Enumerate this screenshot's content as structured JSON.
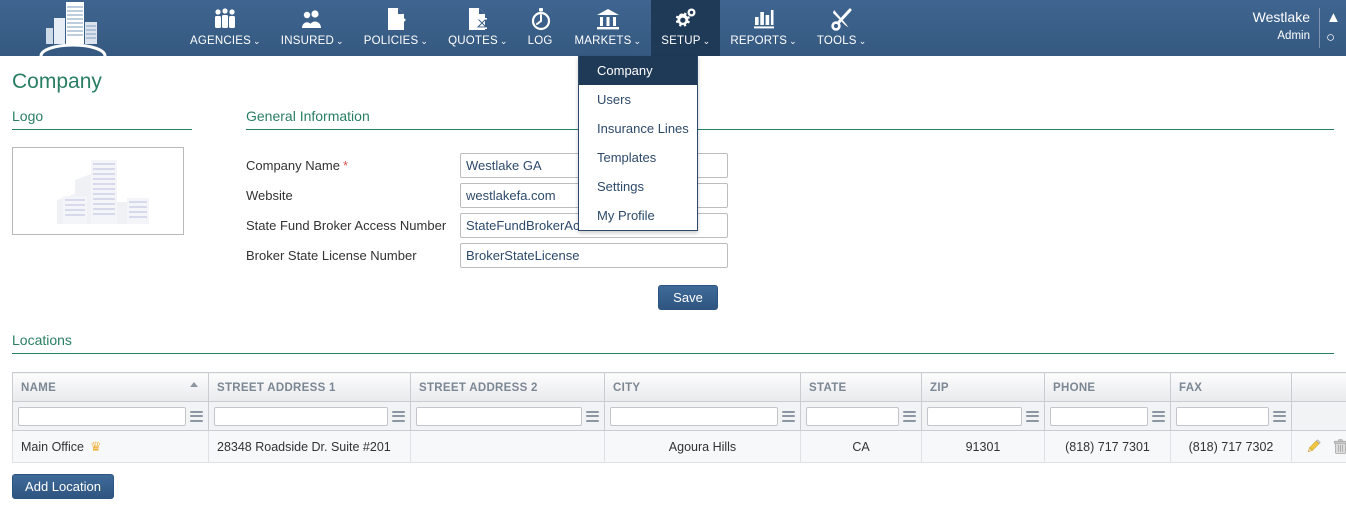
{
  "topbar": {
    "logo_icon": "building-skyline-logo",
    "nav": [
      {
        "label": "AGENCIES",
        "icon": "agencies-people-icon",
        "caret": "⌄",
        "active": false
      },
      {
        "label": "INSURED",
        "icon": "insured-users-icon",
        "caret": "⌄",
        "active": false
      },
      {
        "label": "POLICIES",
        "icon": "policies-doc-check-icon",
        "caret": "⌄",
        "active": false
      },
      {
        "label": "QUOTES",
        "icon": "quotes-doc-hourglass-icon",
        "caret": "⌄",
        "active": false
      },
      {
        "label": "LOG",
        "icon": "log-stopwatch-icon",
        "caret": "",
        "active": false
      },
      {
        "label": "MARKETS",
        "icon": "markets-bank-icon",
        "caret": "⌄",
        "active": false
      },
      {
        "label": "SETUP",
        "icon": "setup-gears-icon",
        "caret": "⌄",
        "active": true
      },
      {
        "label": "REPORTS",
        "icon": "reports-bar-chart-icon",
        "caret": "⌄",
        "active": false
      },
      {
        "label": "TOOLS",
        "icon": "tools-wrench-screwdriver-icon",
        "caret": "⌄",
        "active": false
      }
    ],
    "user": {
      "name": "Westlake",
      "role": "Admin"
    }
  },
  "dropdown": {
    "items": [
      {
        "label": "Company",
        "active": true
      },
      {
        "label": "Users",
        "active": false
      },
      {
        "label": "Insurance Lines",
        "active": false
      },
      {
        "label": "Templates",
        "active": false
      },
      {
        "label": "Settings",
        "active": false
      },
      {
        "label": "My Profile",
        "active": false
      }
    ]
  },
  "page": {
    "title": "Company",
    "logo_section": "Logo",
    "general_section": "General Information",
    "locations_section": "Locations",
    "logo_placeholder_icon": "building-placeholder-icon"
  },
  "form": {
    "fields": [
      {
        "label": "Company Name",
        "required": true,
        "value": "Westlake GA",
        "placeholder": ""
      },
      {
        "label": "Website",
        "required": false,
        "value": "westlakefa.com",
        "placeholder": ""
      },
      {
        "label": "State Fund Broker Access Number",
        "required": false,
        "value": "StateFundBrokerAccessNumber",
        "placeholder": ""
      },
      {
        "label": "Broker State License Number",
        "required": false,
        "value": "BrokerStateLicense",
        "placeholder": ""
      }
    ],
    "save_label": "Save"
  },
  "locations": {
    "add_label": "Add Location",
    "columns": [
      {
        "key": "name",
        "label": "NAME",
        "sorted": "asc",
        "align": "left"
      },
      {
        "key": "addr1",
        "label": "STREET ADDRESS 1",
        "sorted": "none",
        "align": "left"
      },
      {
        "key": "addr2",
        "label": "STREET ADDRESS 2",
        "sorted": "none",
        "align": "left"
      },
      {
        "key": "city",
        "label": "CITY",
        "sorted": "none",
        "align": "center"
      },
      {
        "key": "state",
        "label": "STATE",
        "sorted": "none",
        "align": "center"
      },
      {
        "key": "zip",
        "label": "ZIP",
        "sorted": "none",
        "align": "center"
      },
      {
        "key": "phone",
        "label": "PHONE",
        "sorted": "none",
        "align": "center"
      },
      {
        "key": "fax",
        "label": "FAX",
        "sorted": "none",
        "align": "center"
      },
      {
        "key": "actions",
        "label": "",
        "sorted": "none",
        "align": "left"
      }
    ],
    "filters": {
      "name": "",
      "addr1": "",
      "addr2": "",
      "city": "",
      "state": "",
      "zip": "",
      "phone": "",
      "fax": ""
    },
    "rows": [
      {
        "name": "Main Office",
        "primary_badge": "♛",
        "addr1": "28348 Roadside Dr. Suite #201",
        "addr2": "",
        "city": "Agoura Hills",
        "state": "CA",
        "zip": "91301",
        "phone": "(818) 717 7301",
        "fax": "(818) 717 7302",
        "edit_icon": "pencil-edit-icon",
        "delete_icon": "trash-delete-icon"
      }
    ]
  },
  "colors": {
    "nav_bg": "#3a5f8a",
    "nav_active_bg": "#1f3a57",
    "heading_green": "#2a7f62",
    "input_text": "#2d4a6b",
    "required_red": "#d9534f",
    "crown_gold": "#f0b23c"
  }
}
